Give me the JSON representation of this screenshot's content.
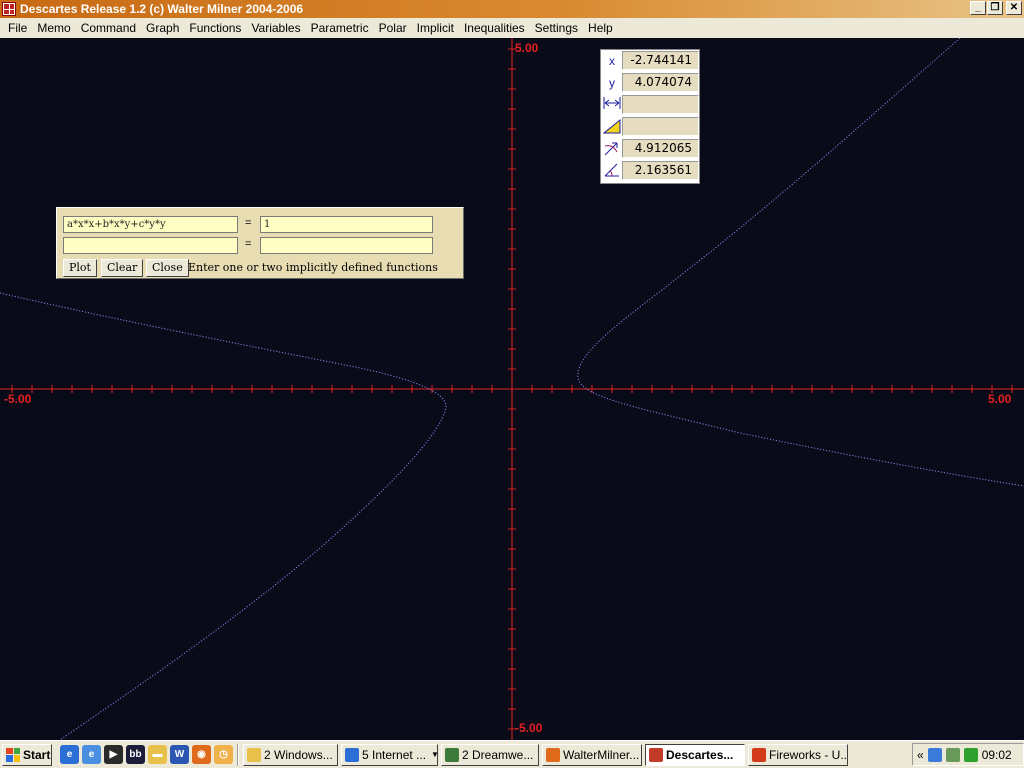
{
  "window": {
    "title": "Descartes Release 1.2 (c) Walter Milner 2004-2006"
  },
  "menu": [
    "File",
    "Memo",
    "Command",
    "Graph",
    "Functions",
    "Variables",
    "Parametric",
    "Polar",
    "Implicit",
    "Inequalities",
    "Settings",
    "Help"
  ],
  "axes": {
    "x_min": "-5.00",
    "x_max": "5.00",
    "y_max": "5.00",
    "y_min": "-5.00",
    "axis_color": "#e42020",
    "curve_color": "#7a86e8",
    "background": "#0a0b18"
  },
  "coord_panel": {
    "x_label": "x",
    "x_value": "-2.744141",
    "y_label": "y",
    "y_value": "4.074074",
    "width_value": "",
    "area_value": "",
    "radius_value": "4.912065",
    "angle_value": "2.163561"
  },
  "implicit": {
    "lhs1": "a*x*x+b*x*y+c*y*y",
    "rhs1": "1",
    "lhs2": "",
    "rhs2": "",
    "equals": "=",
    "plot_label": "Plot",
    "clear_label": "Clear",
    "close_label": "Close",
    "hint": "Enter one or two implicitly defined functions"
  },
  "taskbar": {
    "start_label": "Start",
    "tasks": [
      {
        "label": "2 Windows...",
        "dropdown": true
      },
      {
        "label": "5 Internet ...",
        "dropdown": true
      },
      {
        "label": "2 Dreamwe...",
        "dropdown": true
      },
      {
        "label": "WalterMilner...",
        "dropdown": false
      },
      {
        "label": "Descartes...",
        "dropdown": false,
        "active": true
      },
      {
        "label": "Fireworks - U...",
        "dropdown": false
      }
    ],
    "tray_chevron": "«",
    "clock": "09:02"
  }
}
